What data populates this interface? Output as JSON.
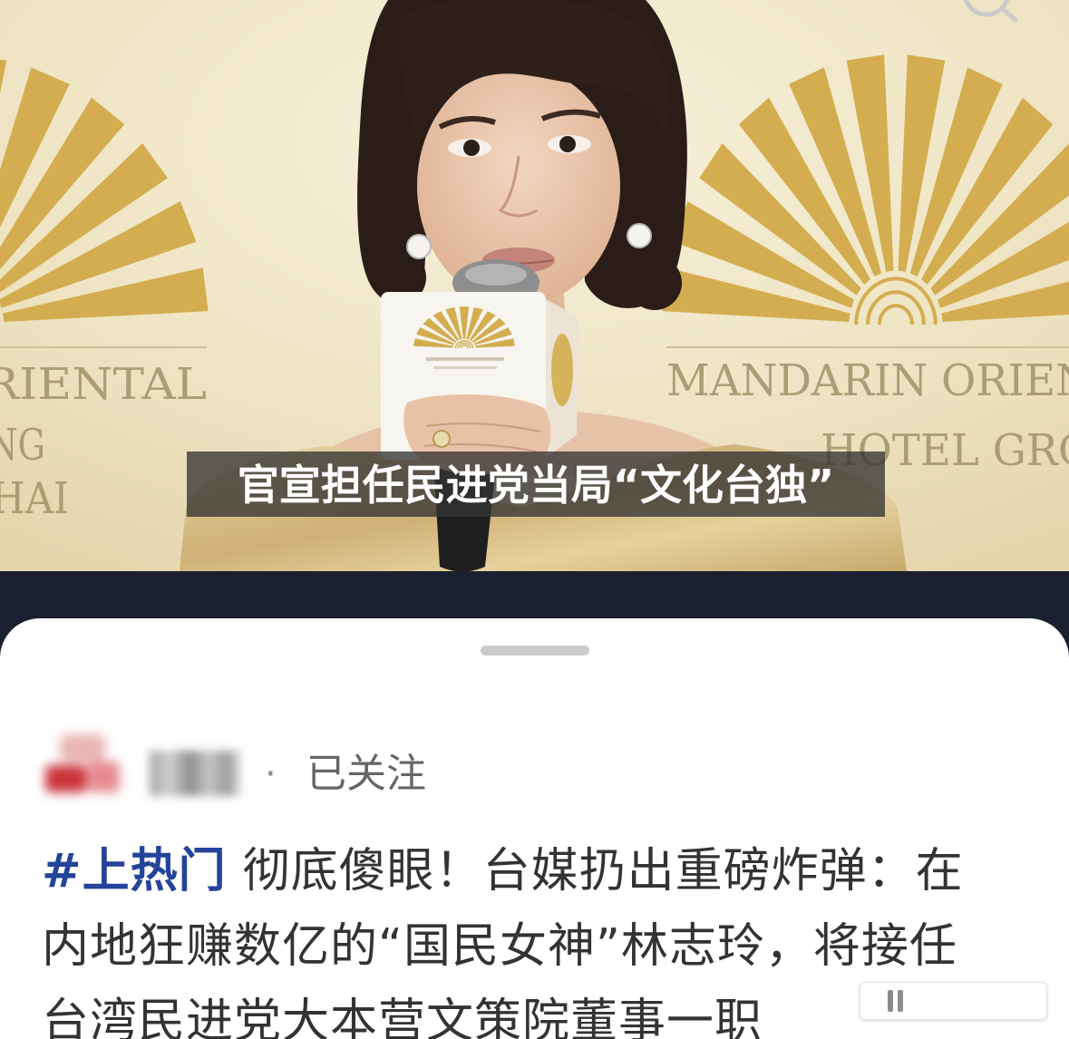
{
  "video": {
    "subtitle": "官宣担任民进党当局“文化台独”",
    "backdrop_left": [
      "RIENTAL",
      "NG",
      "HAI"
    ],
    "backdrop_right": [
      "MANDARIN ORIEN",
      "HOTEL GRO"
    ]
  },
  "author": {
    "follow_separator": "·",
    "follow_status": "已关注"
  },
  "post": {
    "hashtag": "#上热门",
    "body_lines": [
      "彻底傻眼！台媒扔出重磅炸弹：在",
      "内地狂赚数亿的“国民女神”林志玲，将接任",
      "台湾民进党大本营文策院董事一职"
    ]
  },
  "icons": {
    "top_right": "search-icon",
    "corner_mark": "watermark-logo"
  },
  "colors": {
    "hashtag": "#24449a",
    "background": "#1b2030",
    "fan_gold": "#d3ad4f"
  }
}
